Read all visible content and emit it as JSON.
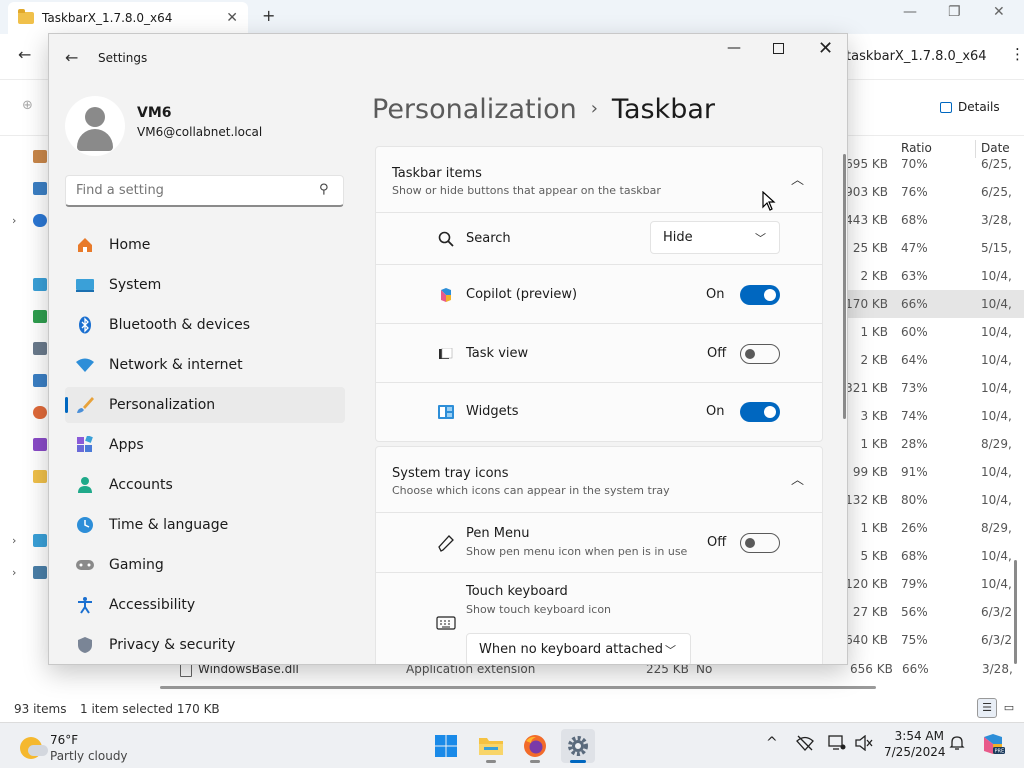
{
  "explorer": {
    "tab_title": "TaskbarX_1.7.8.0_x64",
    "new_tab": "+",
    "address": "taskbarX_1.7.8.0_x64",
    "details_label": "Details",
    "columns": {
      "ratio": "Ratio",
      "date": "Date"
    },
    "rows": [
      {
        "size": "695 KB",
        "ratio": "70%",
        "date": "6/25,"
      },
      {
        "size": "903 KB",
        "ratio": "76%",
        "date": "6/25,"
      },
      {
        "size": ",443 KB",
        "ratio": "68%",
        "date": "3/28,"
      },
      {
        "size": "25 KB",
        "ratio": "47%",
        "date": "5/15,"
      },
      {
        "size": "2 KB",
        "ratio": "63%",
        "date": "10/4,"
      },
      {
        "size": "170 KB",
        "ratio": "66%",
        "date": "10/4,",
        "selected": true
      },
      {
        "size": "1 KB",
        "ratio": "60%",
        "date": "10/4,"
      },
      {
        "size": "2 KB",
        "ratio": "64%",
        "date": "10/4,"
      },
      {
        "size": "321 KB",
        "ratio": "73%",
        "date": "10/4,"
      },
      {
        "size": "3 KB",
        "ratio": "74%",
        "date": "10/4,"
      },
      {
        "size": "1 KB",
        "ratio": "28%",
        "date": "8/29,"
      },
      {
        "size": "99 KB",
        "ratio": "91%",
        "date": "10/4,"
      },
      {
        "size": "132 KB",
        "ratio": "80%",
        "date": "10/4,"
      },
      {
        "size": "1 KB",
        "ratio": "26%",
        "date": "8/29,"
      },
      {
        "size": "5 KB",
        "ratio": "68%",
        "date": "10/4,"
      },
      {
        "size": "120 KB",
        "ratio": "79%",
        "date": "10/4,"
      },
      {
        "size": "27 KB",
        "ratio": "56%",
        "date": "6/3/2"
      },
      {
        "size": "640 KB",
        "ratio": "75%",
        "date": "6/3/2"
      }
    ],
    "last_row": {
      "name": "WindowsBase.dll",
      "type": "Application extension",
      "size": "225 KB",
      "compressed": "No",
      "size2": "656 KB",
      "ratio": "66%",
      "date": "3/28,"
    },
    "status": {
      "items": "93 items",
      "selected": "1 item selected  170 KB"
    }
  },
  "settings": {
    "title": "Settings",
    "user": {
      "name": "VM6",
      "email": "VM6@collabnet.local"
    },
    "search_placeholder": "Find a setting",
    "nav": [
      {
        "label": "Home",
        "icon": "home-icon"
      },
      {
        "label": "System",
        "icon": "system-icon"
      },
      {
        "label": "Bluetooth & devices",
        "icon": "bluetooth-icon"
      },
      {
        "label": "Network & internet",
        "icon": "network-icon"
      },
      {
        "label": "Personalization",
        "icon": "brush-icon",
        "active": true
      },
      {
        "label": "Apps",
        "icon": "apps-icon"
      },
      {
        "label": "Accounts",
        "icon": "accounts-icon"
      },
      {
        "label": "Time & language",
        "icon": "globe-icon"
      },
      {
        "label": "Gaming",
        "icon": "gamepad-icon"
      },
      {
        "label": "Accessibility",
        "icon": "accessibility-icon"
      },
      {
        "label": "Privacy & security",
        "icon": "shield-icon"
      }
    ],
    "breadcrumb": {
      "parent": "Personalization",
      "separator": "›",
      "current": "Taskbar"
    },
    "taskbar_items": {
      "title": "Taskbar items",
      "subtitle": "Show or hide buttons that appear on the taskbar",
      "search": {
        "label": "Search",
        "value": "Hide"
      },
      "copilot": {
        "label": "Copilot (preview)",
        "state": "On"
      },
      "taskview": {
        "label": "Task view",
        "state": "Off"
      },
      "widgets": {
        "label": "Widgets",
        "state": "On"
      }
    },
    "system_tray": {
      "title": "System tray icons",
      "subtitle": "Choose which icons can appear in the system tray",
      "pen": {
        "label": "Pen Menu",
        "subtitle": "Show pen menu icon when pen is in use",
        "state": "Off"
      },
      "touch": {
        "label": "Touch keyboard",
        "subtitle": "Show touch keyboard icon",
        "value": "When no keyboard attached"
      }
    },
    "accent_color": "#0067c0"
  },
  "taskbar": {
    "weather": {
      "temp": "76°F",
      "condition": "Partly cloudy"
    },
    "clock": {
      "time": "3:54 AM",
      "date": "7/25/2024"
    },
    "tray_chevron": "^"
  }
}
